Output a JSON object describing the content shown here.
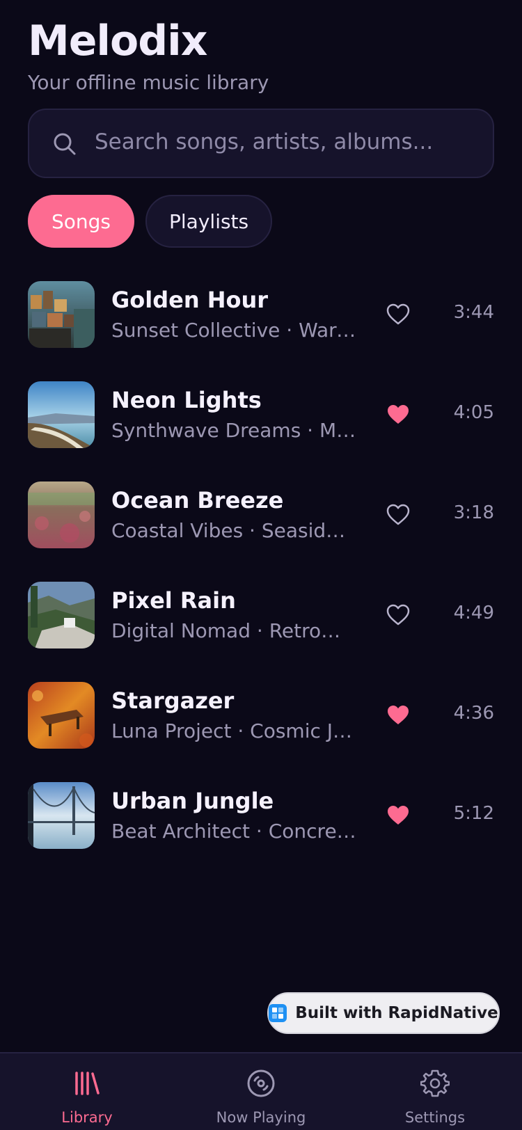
{
  "app": {
    "title": "Melodix",
    "subtitle": "Your offline music library"
  },
  "search": {
    "placeholder": "Search songs, artists, albums...",
    "icon": "search-icon"
  },
  "tabs": [
    {
      "label": "Songs",
      "active": true
    },
    {
      "label": "Playlists",
      "active": false
    }
  ],
  "songs": [
    {
      "title": "Golden Hour",
      "subtitle": "Sunset Collective · Warm Nights",
      "favorite": false,
      "duration": "3:44"
    },
    {
      "title": "Neon Lights",
      "subtitle": "Synthwave Dreams · Midnight Drive",
      "favorite": true,
      "duration": "4:05"
    },
    {
      "title": "Ocean Breeze",
      "subtitle": "Coastal Vibes · Seaside Chill",
      "favorite": false,
      "duration": "3:18"
    },
    {
      "title": "Pixel Rain",
      "subtitle": "Digital Nomad · Retrowave",
      "favorite": false,
      "duration": "4:49"
    },
    {
      "title": "Stargazer",
      "subtitle": "Luna Project · Cosmic Journey",
      "favorite": true,
      "duration": "4:36"
    },
    {
      "title": "Urban Jungle",
      "subtitle": "Beat Architect · Concrete Beats",
      "favorite": true,
      "duration": "5:12"
    }
  ],
  "badge": {
    "label": "Built with RapidNative"
  },
  "nav": [
    {
      "label": "Library",
      "icon": "library-icon",
      "active": true
    },
    {
      "label": "Now Playing",
      "icon": "disc-icon",
      "active": false
    },
    {
      "label": "Settings",
      "icon": "gear-icon",
      "active": false
    }
  ],
  "colors": {
    "background": "#0b0918",
    "surface": "#16132b",
    "accent": "#fd6b91",
    "muted_text": "#9d98b3"
  }
}
